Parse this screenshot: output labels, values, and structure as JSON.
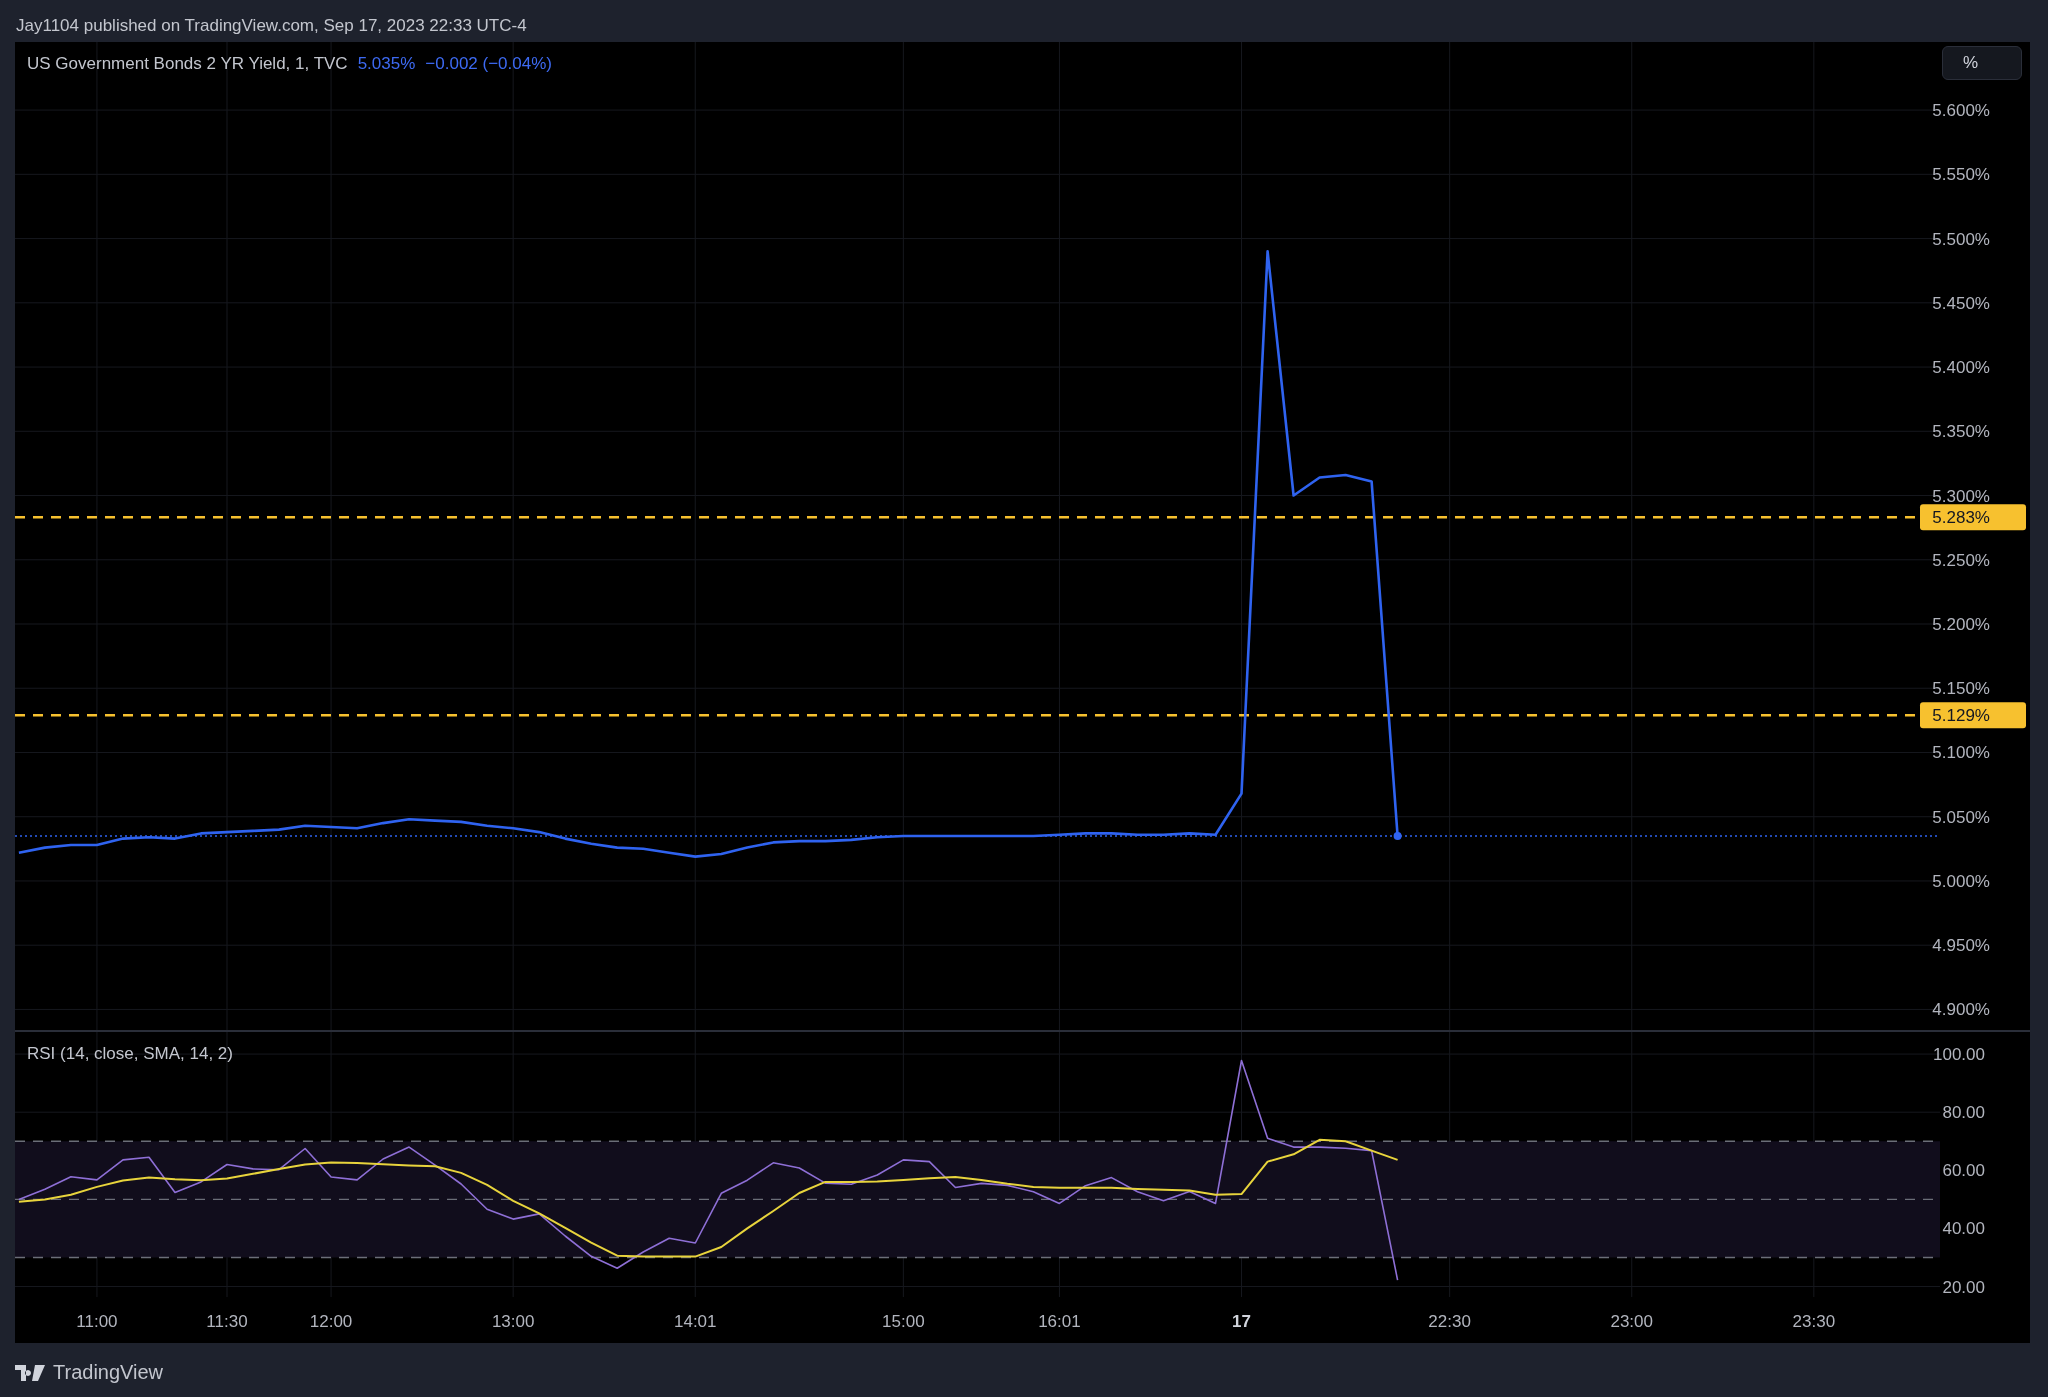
{
  "header": {
    "text": "Jay1104 published on TradingView.com, Sep 17, 2023 22:33 UTC-4"
  },
  "price_pane": {
    "legend": {
      "symbol": "US Government Bonds 2 YR Yield, 1, TVC",
      "value": "5.035%",
      "change": "−0.002 (−0.04%)"
    },
    "scale_button": "%",
    "chart_data": {
      "type": "line",
      "grid": true,
      "ylim": [
        4.884,
        5.653
      ],
      "series": [
        {
          "color": "#2f63f0",
          "values": [
            5.022,
            5.026,
            5.028,
            5.028,
            5.033,
            5.034,
            5.033,
            5.037,
            5.038,
            5.039,
            5.04,
            5.043,
            5.042,
            5.041,
            5.045,
            5.048,
            5.047,
            5.046,
            5.043,
            5.041,
            5.038,
            5.033,
            5.029,
            5.026,
            5.025,
            5.022,
            5.019,
            5.021,
            5.026,
            5.03,
            5.031,
            5.031,
            5.032,
            5.034,
            5.035,
            5.035,
            5.035,
            5.035,
            5.035,
            5.035,
            5.036,
            5.037,
            5.037,
            5.036,
            5.036,
            5.037,
            5.036,
            5.068,
            5.49,
            5.3,
            5.314,
            5.316,
            5.311,
            5.035,
            null,
            null,
            null,
            null,
            null,
            null,
            null,
            null,
            null,
            null,
            null,
            null,
            null,
            null,
            null,
            null,
            null,
            null,
            null,
            null
          ]
        }
      ],
      "yticks": [
        {
          "value": 4.9,
          "label": "4.900%"
        },
        {
          "value": 4.95,
          "label": "4.950%"
        },
        {
          "value": 5.0,
          "label": "5.000%"
        },
        {
          "value": 5.05,
          "label": "5.050%"
        },
        {
          "value": 5.1,
          "label": "5.100%"
        },
        {
          "value": 5.15,
          "label": "5.150%"
        },
        {
          "value": 5.2,
          "label": "5.200%"
        },
        {
          "value": 5.25,
          "label": "5.250%"
        },
        {
          "value": 5.3,
          "label": "5.300%"
        },
        {
          "value": 5.35,
          "label": "5.350%"
        },
        {
          "value": 5.4,
          "label": "5.400%"
        },
        {
          "value": 5.45,
          "label": "5.450%"
        },
        {
          "value": 5.5,
          "label": "5.500%"
        },
        {
          "value": 5.55,
          "label": "5.550%"
        },
        {
          "value": 5.6,
          "label": "5.600%"
        }
      ],
      "ref_lines": [
        {
          "axis": "y",
          "value": 5.283,
          "label": "5.283%",
          "color": "#f7c12f"
        },
        {
          "axis": "y",
          "value": 5.129,
          "label": "5.129%",
          "color": "#f7c12f"
        },
        {
          "axis": "y",
          "value": 5.035,
          "color": "#2f63f0"
        }
      ]
    }
  },
  "rsi_pane": {
    "legend": "RSI (14, close, SMA, 14, 2)",
    "chart_data": {
      "type": "line",
      "grid": true,
      "ylim": [
        16.4,
        107.6
      ],
      "categories": [
        null,
        null,
        null,
        "11:00",
        null,
        null,
        null,
        null,
        "11:30",
        null,
        null,
        null,
        "12:00",
        null,
        null,
        null,
        null,
        null,
        null,
        "13:00",
        null,
        null,
        null,
        null,
        null,
        null,
        "14:01",
        null,
        null,
        null,
        null,
        null,
        null,
        null,
        "15:00",
        null,
        null,
        null,
        null,
        null,
        "16:01",
        null,
        null,
        null,
        null,
        null,
        null,
        "17",
        null,
        null,
        null,
        null,
        null,
        null,
        null,
        "22:30",
        null,
        null,
        null,
        null,
        null,
        null,
        "23:00",
        null,
        null,
        null,
        null,
        null,
        null,
        "23:30",
        null,
        null,
        null,
        null
      ],
      "series": [
        {
          "color": "#8e6fd6",
          "values": [
            50,
            53.5,
            57.8,
            56.7,
            63.6,
            64.5,
            52.4,
            56,
            62,
            60.5,
            60.2,
            67.5,
            57.7,
            56.7,
            63.9,
            68,
            61.8,
            55.3,
            46.6,
            43.2,
            45,
            37.4,
            30.4,
            26.3,
            31.9,
            36.6,
            35,
            52.1,
            56.6,
            62.6,
            60.8,
            55.6,
            55.2,
            58.4,
            63.6,
            63,
            54.1,
            55.5,
            54.8,
            52.6,
            48.6,
            54.7,
            57.5,
            52.6,
            49.5,
            52.7,
            48.6,
            97.8,
            71,
            68,
            68,
            67.6,
            66.8,
            22.2,
            null,
            null,
            null,
            null,
            null,
            null,
            null,
            null,
            null,
            null,
            null,
            null,
            null,
            null,
            null,
            null,
            null,
            null,
            null,
            null
          ]
        },
        {
          "color": "#e8d43c",
          "values": [
            49.2,
            50,
            51.6,
            54.3,
            56.5,
            57.5,
            56.9,
            56.6,
            57.2,
            58.8,
            60.4,
            62,
            62.7,
            62.5,
            62.1,
            61.7,
            61.4,
            59.1,
            55,
            49.5,
            45.2,
            40.2,
            35.1,
            30.6,
            30.3,
            30.3,
            30.3,
            33.6,
            40,
            46,
            52.2,
            56,
            56,
            56.2,
            56.7,
            57.3,
            57.7,
            56.7,
            55.4,
            54.3,
            54,
            54,
            54,
            53.6,
            53.3,
            53.1,
            51.6,
            51.8,
            63,
            65.5,
            70.5,
            70,
            66.8,
            63.6,
            null,
            null,
            null,
            null,
            null,
            null,
            null,
            null,
            null,
            null,
            null,
            null,
            null,
            null,
            null,
            null,
            null,
            null,
            null,
            null
          ]
        }
      ],
      "yticks": [
        {
          "value": 20,
          "label": "20.00"
        },
        {
          "value": 40,
          "label": "40.00"
        },
        {
          "value": 60,
          "label": "60.00"
        },
        {
          "value": 80,
          "label": "80.00"
        },
        {
          "value": 100,
          "label": "100.00"
        }
      ],
      "bands": [
        {
          "axis": "y",
          "from": 30,
          "to": 70
        }
      ],
      "ref_lines": [
        {
          "axis": "y",
          "value": 70
        },
        {
          "axis": "y",
          "value": 50
        },
        {
          "axis": "y",
          "value": 30
        }
      ]
    }
  },
  "footer": {
    "brand": "TradingView"
  }
}
